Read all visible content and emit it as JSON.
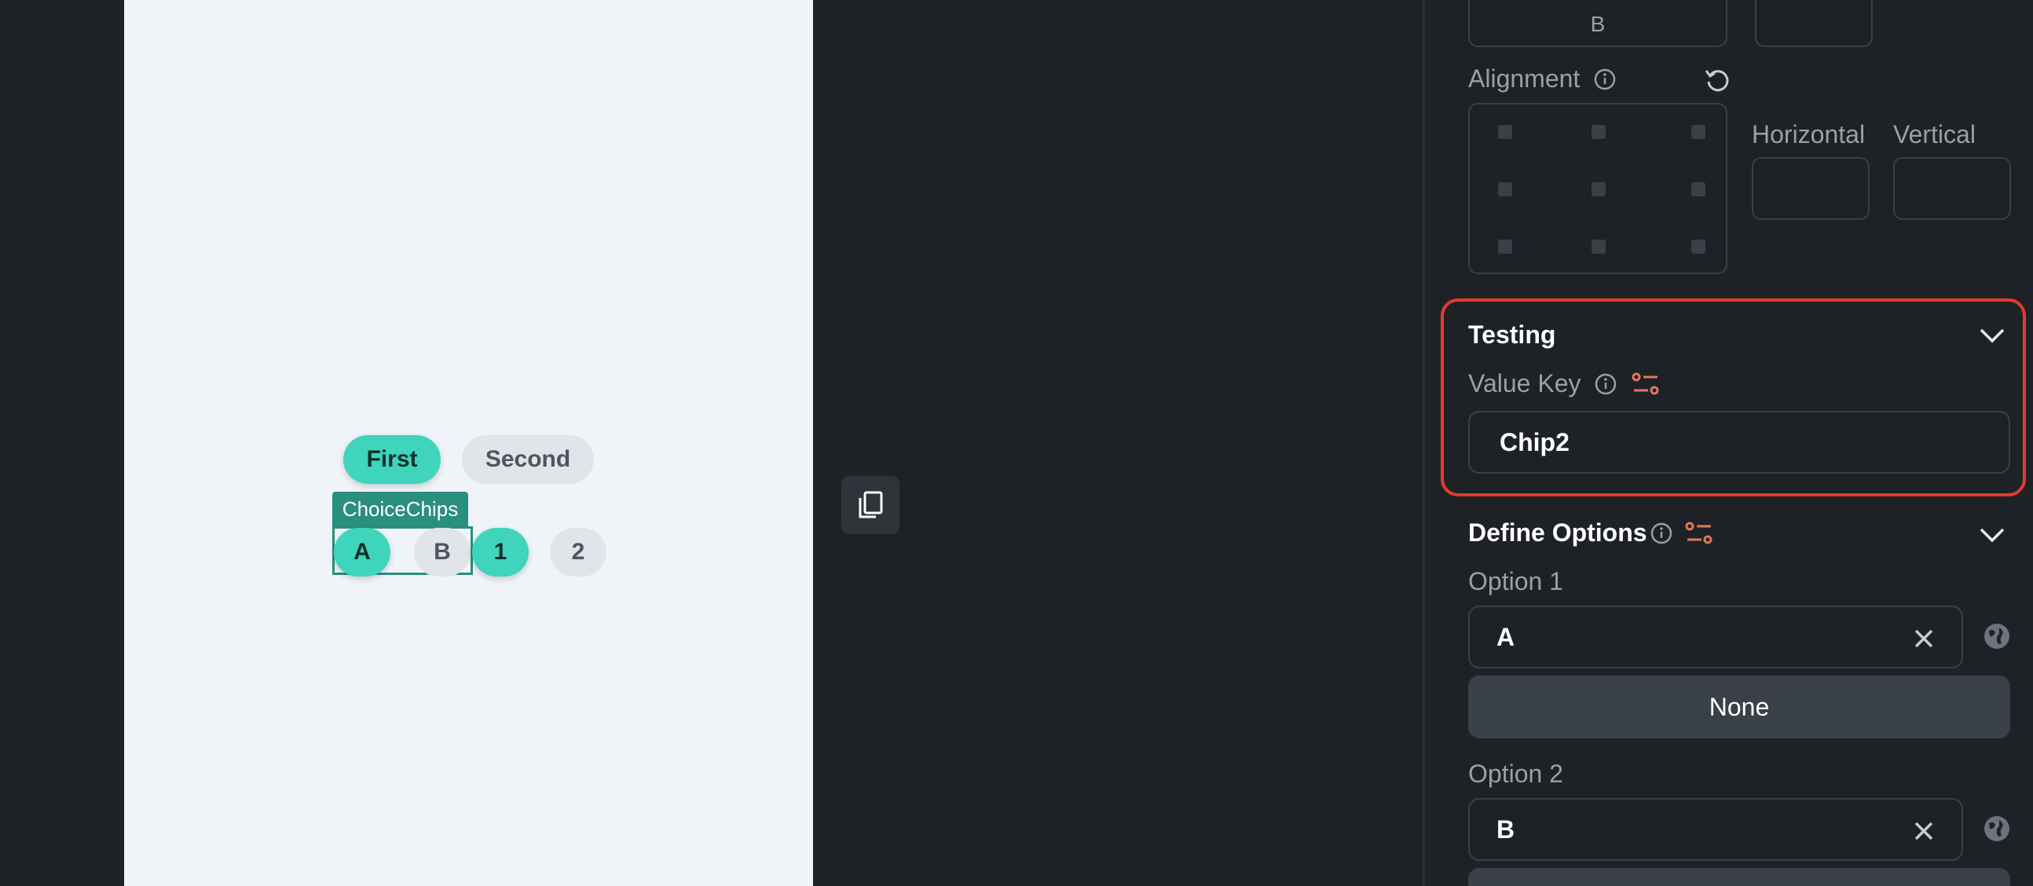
{
  "canvas": {
    "chips_row1": [
      {
        "label": "First",
        "selected": true
      },
      {
        "label": "Second",
        "selected": false
      }
    ],
    "widget_tag": "ChoiceChips",
    "chips_row2": [
      {
        "label": "A",
        "selected": true
      },
      {
        "label": "B",
        "selected": false
      },
      {
        "label": "1",
        "selected": true
      },
      {
        "label": "2",
        "selected": false
      }
    ]
  },
  "panel": {
    "top_field_value": "B",
    "alignment": {
      "label": "Alignment",
      "horizontal_label": "Horizontal",
      "vertical_label": "Vertical"
    },
    "testing": {
      "title": "Testing",
      "value_key_label": "Value Key",
      "value_key": "Chip2"
    },
    "define_options": {
      "title": "Define Options",
      "options": [
        {
          "label": "Option 1",
          "value": "A",
          "button": "None"
        },
        {
          "label": "Option 2",
          "value": "B"
        }
      ]
    }
  },
  "colors": {
    "accent_chip": "#3fd4bc",
    "highlight": "#e53a2f",
    "variable_icon": "#e2775a"
  }
}
